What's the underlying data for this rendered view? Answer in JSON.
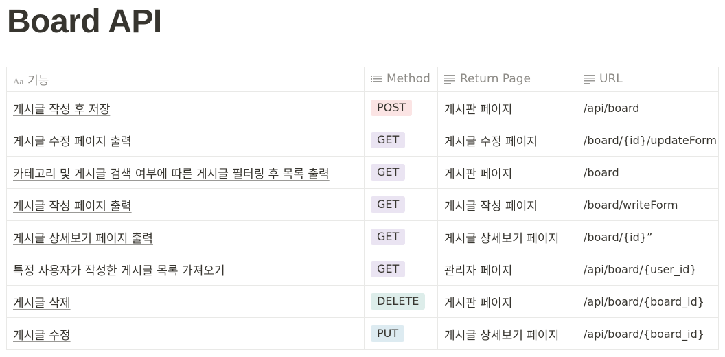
{
  "page": {
    "title": "Board API"
  },
  "table": {
    "headers": {
      "feature": "기능",
      "method": "Method",
      "return_page": "Return Page",
      "url": "URL"
    },
    "rows": [
      {
        "feature": "게시글 작성 후 저장",
        "method": "POST",
        "return_page": "게시판 페이지",
        "url": "/api/board"
      },
      {
        "feature": "게시글 수정 페이지 출력",
        "method": "GET",
        "return_page": "게시글 수정 페이지",
        "url": "/board/{id}/updateForm"
      },
      {
        "feature": "카테고리 및 게시글 검색 여부에 따른 게시글 필터링 후 목록 출력",
        "method": "GET",
        "return_page": "게시판 페이지",
        "url": "/board"
      },
      {
        "feature": "게시글 작성 페이지 출력",
        "method": "GET",
        "return_page": "게시글 작성 페이지",
        "url": "/board/writeForm"
      },
      {
        "feature": "게시글 상세보기 페이지 출력",
        "method": "GET",
        "return_page": "게시글 상세보기 페이지",
        "url": "/board/{id}”"
      },
      {
        "feature": "특정 사용자가 작성한 게시글 목록 가져오기",
        "method": "GET",
        "return_page": "관리자 페이지",
        "url": "/api/board/{user_id}"
      },
      {
        "feature": "게시글 삭제",
        "method": "DELETE",
        "return_page": "게시판 페이지",
        "url": "/api/board/{board_id}"
      },
      {
        "feature": "게시글 수정",
        "method": "PUT",
        "return_page": "게시글 상세보기 페이지",
        "url": "/api/board/{board_id}"
      }
    ]
  },
  "method_colors": {
    "POST": "#fbe4e4",
    "GET": "#eae4f2",
    "DELETE": "#ddedea",
    "PUT": "#ddebf1"
  },
  "icons": {
    "feature": "title-aa-icon",
    "method": "list-icon",
    "return_page": "text-lines-icon",
    "url": "text-lines-icon"
  }
}
